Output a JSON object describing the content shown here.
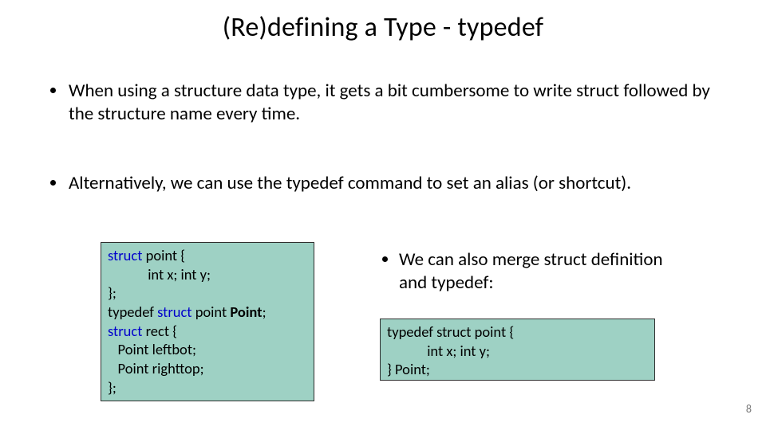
{
  "title": "(Re)defining a Type - typedef",
  "bullets": {
    "first": {
      "pre": "When using a structure data type, it gets a bit cumbersome to write ",
      "kw": "struct",
      "post": " followed by the structure name every time."
    },
    "second": {
      "pre": "Alternatively, we can use the ",
      "kw": "typedef",
      "post": " command to set an alias (or shortcut)."
    }
  },
  "code_left": {
    "l1a": "struct",
    "l1b": " point {",
    "l2": "            int x; int y;",
    "l3": "};",
    "l4a": "typedef ",
    "l4b": "struct",
    "l4c": " point ",
    "l4d": "Point",
    "l4e": ";",
    "l5a": "struct",
    "l5b": " rect {",
    "l6": "   Point leftbot;",
    "l7": "   Point righttop;",
    "l8": "};"
  },
  "right_bullet": "We can also merge struct definition and typedef:",
  "code_right": {
    "l1": "typedef struct point {",
    "l2": "            int x; int y;",
    "l3": "} Point;"
  },
  "page_number": "8"
}
